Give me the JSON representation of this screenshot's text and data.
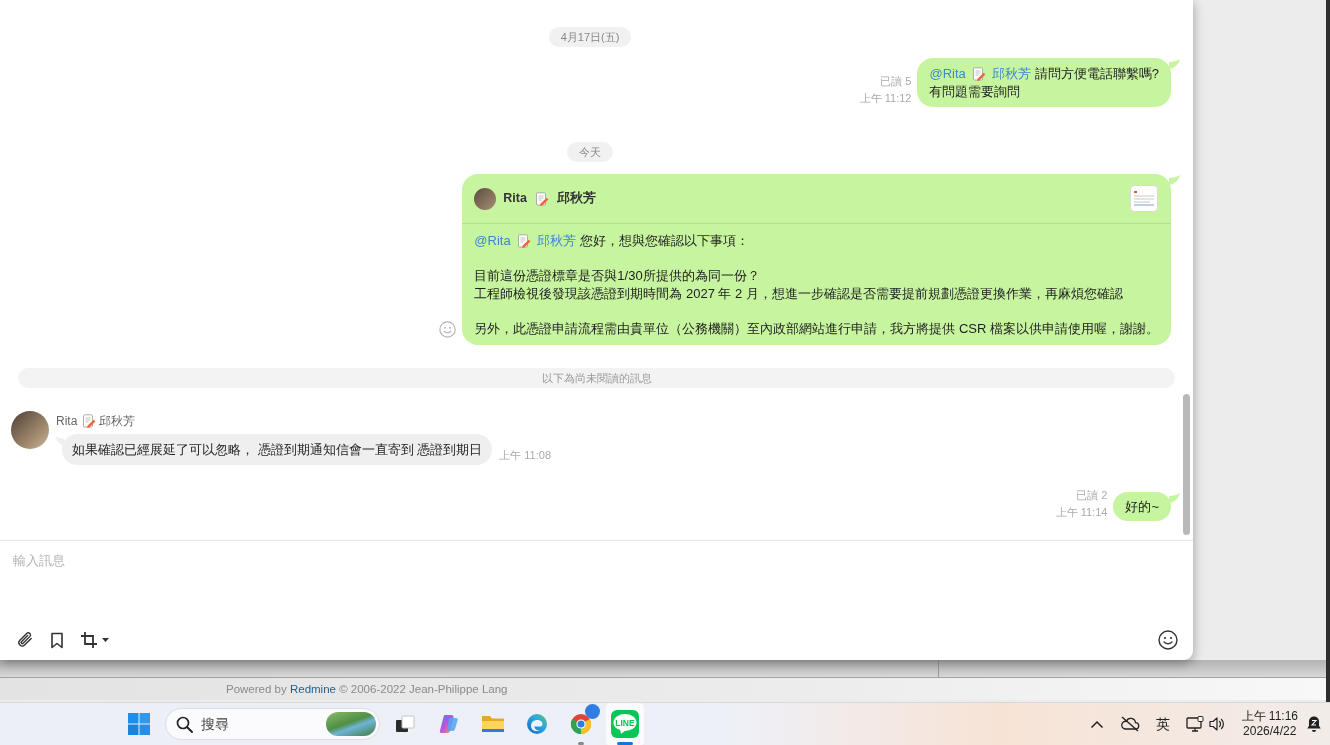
{
  "chat": {
    "messages": [
      {
        "kind": "date",
        "text": "4月17日(五)"
      },
      {
        "kind": "sent",
        "read_receipt": "已讀 5",
        "time": "上午 11:12",
        "mention": {
          "handle": "@Rita",
          "name": "邱秋芳"
        },
        "lines": [
          "請問方便電話聯繫嗎?",
          "有問題需要詢問"
        ]
      },
      {
        "kind": "date",
        "text": "今天"
      },
      {
        "kind": "card",
        "sender": {
          "handle": "Rita",
          "name": "邱秋芳"
        },
        "mention": {
          "handle": "@Rita",
          "name": "邱秋芳"
        },
        "paragraphs": [
          [
            "您好，想與您確認以下事項："
          ],
          [
            "目前這份憑證標章是否與1/30所提供的為同一份？",
            "工程師檢視後發現該憑證到期時間為 2027 年 2 月，想進一步確認是否需要提前規劃憑證更換作業，再麻煩您確認"
          ],
          [
            "另外，此憑證申請流程需由貴單位（公務機關）至內政部網站進行申請，我方將提供 CSR 檔案以供申請使用喔，謝謝。"
          ]
        ]
      },
      {
        "kind": "unread_divider",
        "text": "以下為尚未閱讀的訊息"
      },
      {
        "kind": "received",
        "sender": {
          "handle": "Rita",
          "name": "邱秋芳"
        },
        "lines": [
          "如果確認已經展延了可以忽略， 憑證到期通知信會一直寄到 憑證到期日"
        ],
        "time": "上午 11:08"
      },
      {
        "kind": "sent",
        "read_receipt": "已讀 2",
        "time": "上午 11:14",
        "lines": [
          "好的~"
        ]
      }
    ],
    "composer": {
      "placeholder": "輸入訊息"
    }
  },
  "footer": {
    "prefix": "Powered by",
    "link": "Redmine",
    "suffix": "© 2006-2022 Jean-Philippe Lang"
  },
  "taskbar": {
    "search": {
      "placeholder": "搜尋"
    },
    "apps": [
      {
        "kind": "task_view",
        "selected": false,
        "running": false
      },
      {
        "kind": "copilot",
        "selected": false,
        "running": false
      },
      {
        "kind": "explorer",
        "selected": false,
        "running": false
      },
      {
        "kind": "edge",
        "selected": false,
        "running": false
      },
      {
        "kind": "chrome",
        "selected": false,
        "running": true
      },
      {
        "kind": "line",
        "selected": true,
        "running": true,
        "logo_text": "LINE"
      }
    ],
    "tray": {
      "ime": "英",
      "time": "上午 11:16",
      "date": "2026/4/22"
    }
  }
}
